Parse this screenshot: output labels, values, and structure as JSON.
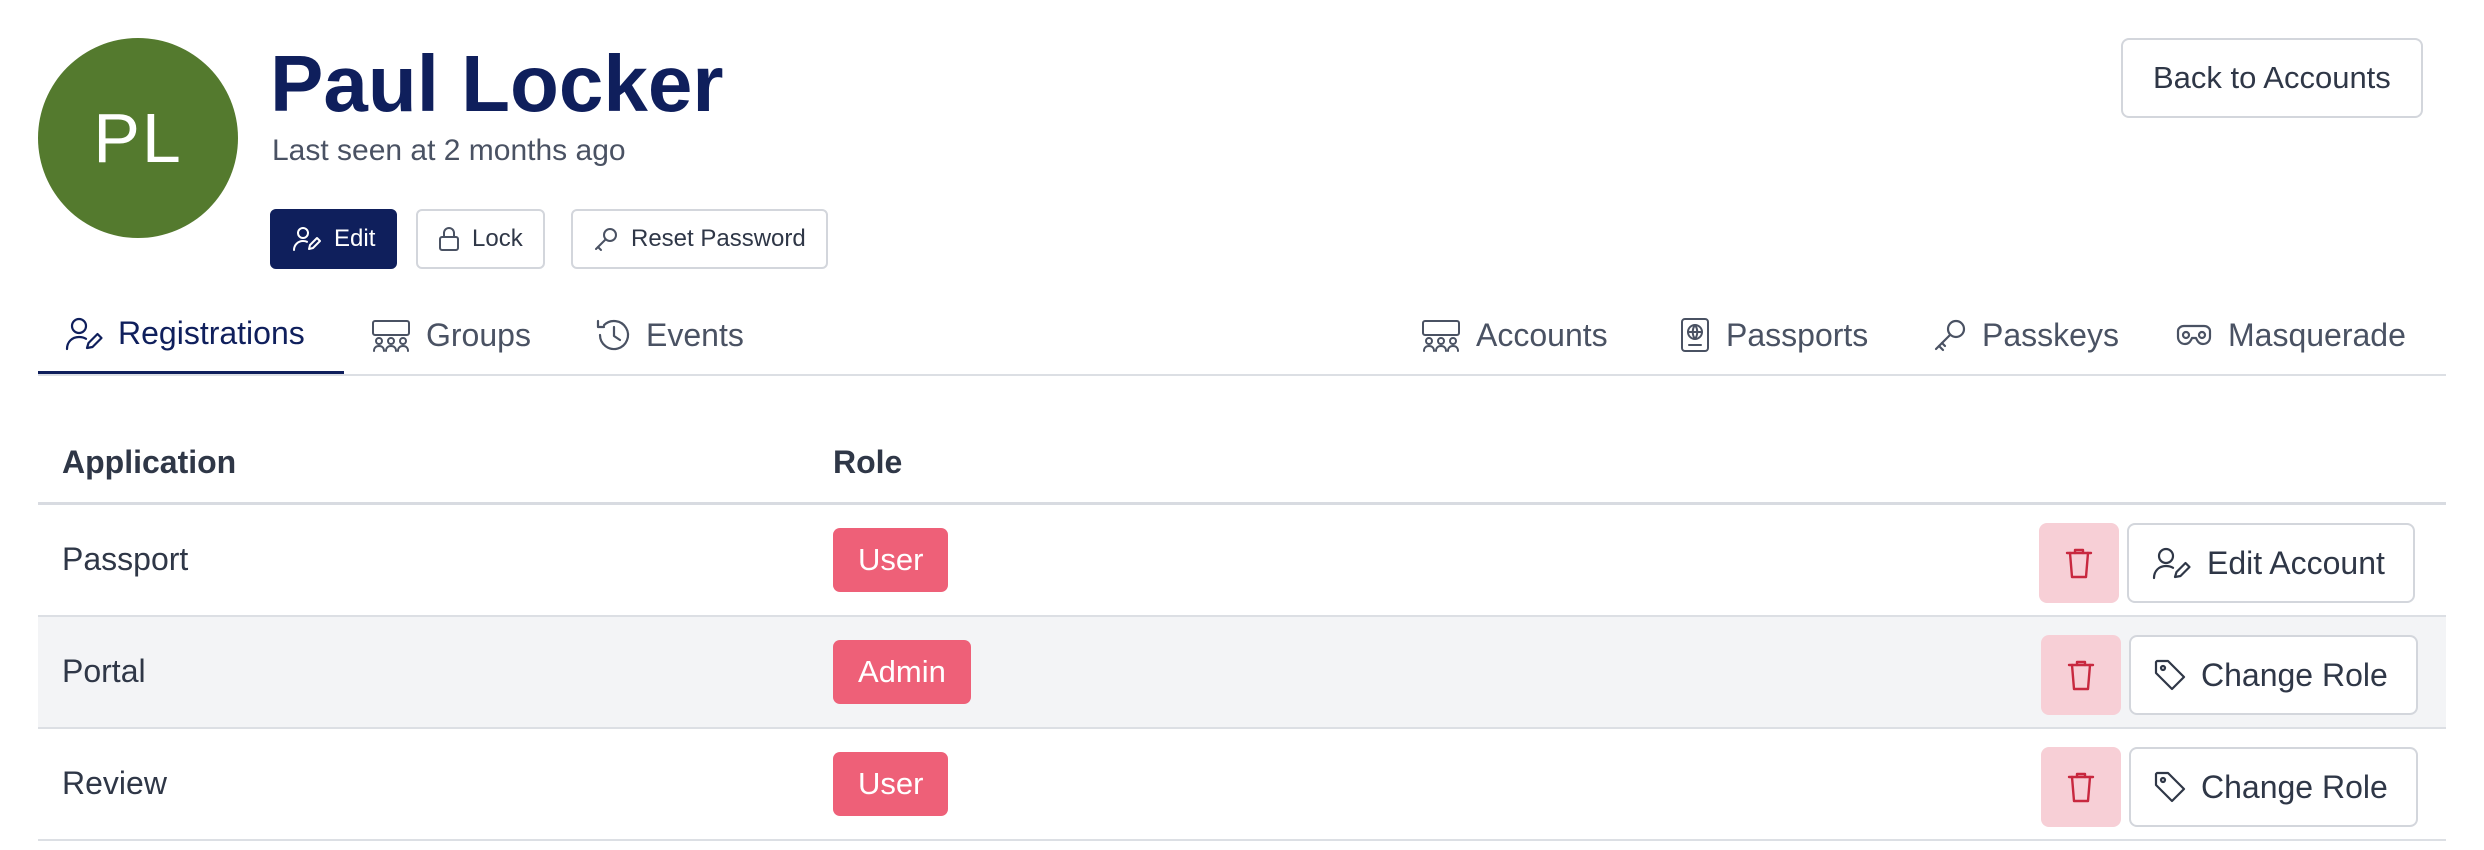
{
  "user": {
    "initials": "PL",
    "name": "Paul Locker",
    "last_seen": "Last seen at 2 months ago",
    "avatar_color": "#547a2e"
  },
  "actions": {
    "edit_label": "Edit",
    "lock_label": "Lock",
    "reset_password_label": "Reset Password",
    "back_label": "Back to Accounts"
  },
  "tabs": {
    "left": [
      {
        "label": "Registrations",
        "icon": "user-registration-icon",
        "active": true
      },
      {
        "label": "Groups",
        "icon": "group-icon",
        "active": false
      },
      {
        "label": "Events",
        "icon": "history-icon",
        "active": false
      }
    ],
    "right": [
      {
        "label": "Accounts",
        "icon": "accounts-icon"
      },
      {
        "label": "Passports",
        "icon": "passport-icon"
      },
      {
        "label": "Passkeys",
        "icon": "key-icon"
      },
      {
        "label": "Masquerade",
        "icon": "mask-icon"
      }
    ]
  },
  "table": {
    "headers": {
      "application": "Application",
      "role": "Role"
    },
    "rows": [
      {
        "application": "Passport",
        "role": "User",
        "action": "Edit Account",
        "action_icon": "user-edit-icon"
      },
      {
        "application": "Portal",
        "role": "Admin",
        "action": "Change Role",
        "action_icon": "tag-icon"
      },
      {
        "application": "Review",
        "role": "User",
        "action": "Change Role",
        "action_icon": "tag-icon"
      }
    ]
  },
  "colors": {
    "primary": "#0f1f5c",
    "badge": "#ee6078",
    "delete_bg": "#f7cfd6",
    "delete_icon": "#c8283f"
  }
}
